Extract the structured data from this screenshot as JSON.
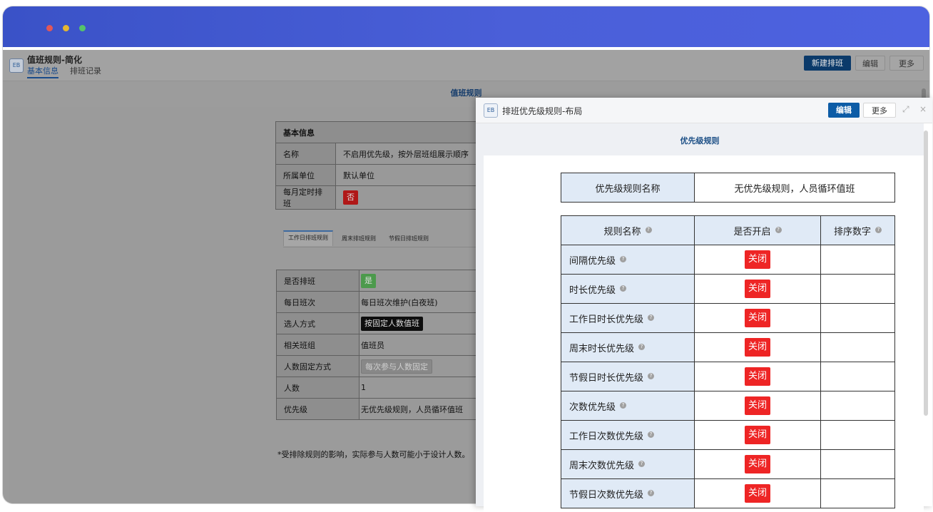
{
  "page": {
    "title": "值班规则-简化",
    "tabs": [
      "基本信息",
      "排班记录"
    ],
    "buttons": {
      "new": "新建排班",
      "edit": "编辑",
      "more": "更多"
    },
    "section_title": "值班规则",
    "basic": {
      "header": "基本信息",
      "rows": [
        {
          "label": "名称",
          "value": "不启用优先级，按外层班组展示顺序"
        },
        {
          "label": "所属单位",
          "value": "默认单位"
        },
        {
          "label": "每月定时排班",
          "badge": "否"
        }
      ]
    },
    "subtabs": [
      "工作日排班规则",
      "周末排班规则",
      "节假日排班规则"
    ],
    "workday": {
      "rows": [
        {
          "label": "是否排班",
          "badge": "是"
        },
        {
          "label": "每日班次",
          "value": "每日班次维护(白夜班)"
        },
        {
          "label": "选人方式",
          "badge": "按固定人数值班"
        },
        {
          "label": "相关班组",
          "value": "值班员"
        },
        {
          "label": "人数固定方式",
          "badge": "每次参与人数固定"
        },
        {
          "label": "人数",
          "value": "1"
        },
        {
          "label": "优先级",
          "value": "无优先级规则，人员循环值班"
        }
      ]
    },
    "note": "*受排除规则的影响，实际参与人数可能小于设计人数。"
  },
  "modal": {
    "badge": "EB",
    "title": "排班优先级规则-布局",
    "edit": "编辑",
    "more": "更多",
    "section_title": "优先级规则",
    "name_label": "优先级规则名称",
    "name_value": "无优先级规则，人员循环值班",
    "columns": [
      "规则名称",
      "是否开启",
      "排序数字"
    ],
    "rules": [
      {
        "name": "间隔优先级",
        "status": "关闭"
      },
      {
        "name": "时长优先级",
        "status": "关闭"
      },
      {
        "name": "工作日时长优先级",
        "status": "关闭"
      },
      {
        "name": "周末时长优先级",
        "status": "关闭"
      },
      {
        "name": "节假日时长优先级",
        "status": "关闭"
      },
      {
        "name": "次数优先级",
        "status": "关闭"
      },
      {
        "name": "工作日次数优先级",
        "status": "关闭"
      },
      {
        "name": "周末次数优先级",
        "status": "关闭"
      },
      {
        "name": "节假日次数优先级",
        "status": "关闭"
      }
    ]
  },
  "app_badge": "EB",
  "colors": {
    "titlebar": "#4a5fd8",
    "primary": "#0d5ca6",
    "off": "#ee2525",
    "label_bg": "#e0eaf6"
  }
}
